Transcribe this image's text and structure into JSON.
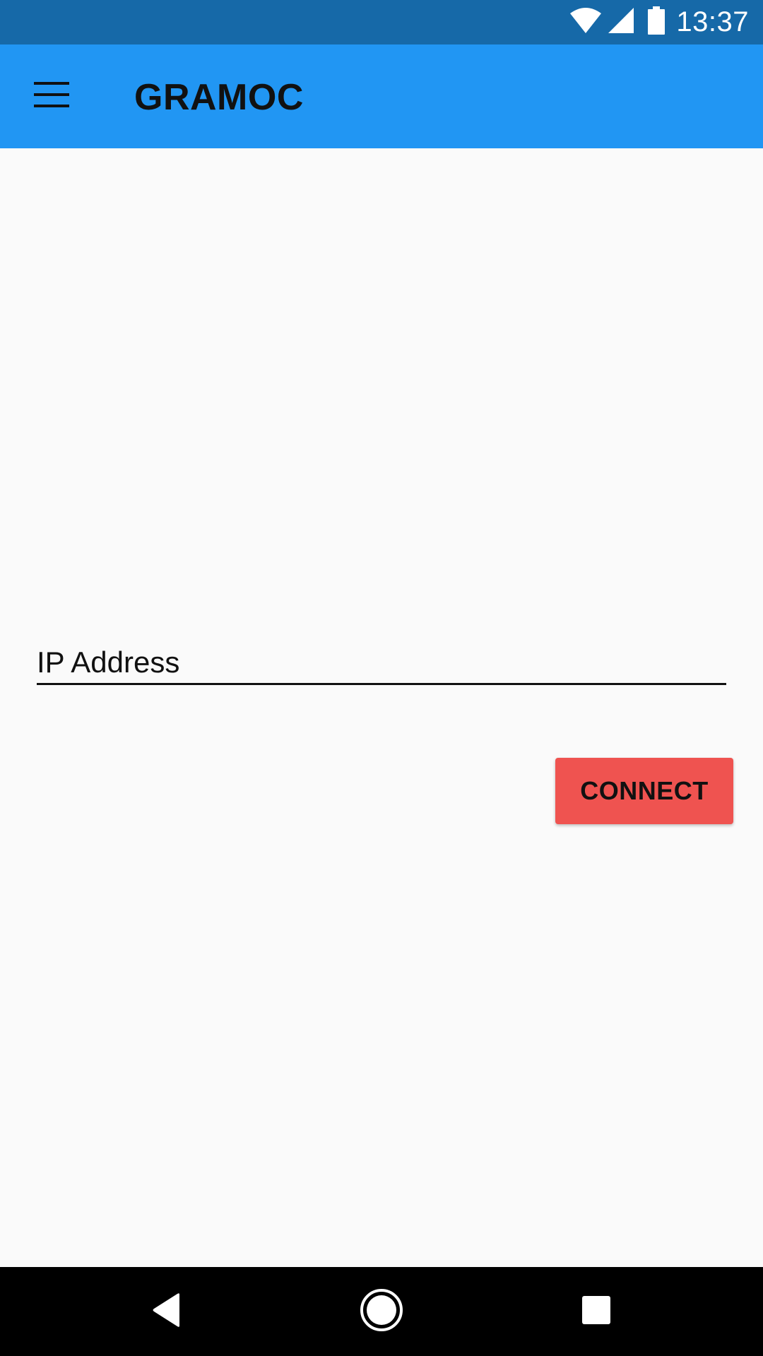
{
  "status_bar": {
    "time": "13:37",
    "icons": [
      "wifi-icon",
      "cell-signal-icon",
      "battery-icon"
    ]
  },
  "app_bar": {
    "title": "GRAMOC",
    "menu_icon": "hamburger-menu-icon"
  },
  "form": {
    "ip_placeholder": "IP Address",
    "ip_value": "",
    "connect_label": "CONNECT"
  },
  "nav_bar": {
    "buttons": [
      "back-icon",
      "home-icon",
      "recents-icon"
    ]
  },
  "colors": {
    "status_bar": "#1669a8",
    "app_bar": "#2196f3",
    "background": "#fafafa",
    "accent": "#ef5350",
    "nav_bar": "#000000"
  }
}
